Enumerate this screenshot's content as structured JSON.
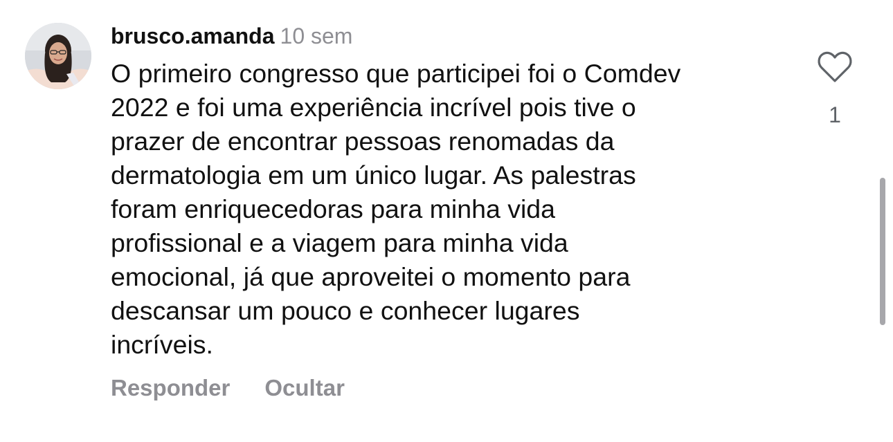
{
  "comment": {
    "username": "brusco.amanda",
    "time": "10 sem",
    "text": "O primeiro congresso que participei foi o Comdev\n2022 e foi uma experiência incrível pois tive o\nprazer de encontrar pessoas renomadas da\ndermatologia em um único lugar. As palestras\nforam enriquecedoras para minha vida\nprofissional e a viagem para minha vida\nemocional, já que aproveitei o momento para\ndescansar um pouco e conhecer lugares\nincríveis.",
    "likes": "1",
    "reply_label": "Responder",
    "hide_label": "Ocultar"
  },
  "icons": {
    "like": "heart-outline-icon",
    "avatar": "profile-photo"
  },
  "colors": {
    "text": "#111111",
    "muted": "#8e8e93",
    "icon": "#5f6368",
    "scrollbar": "#a7a7ab"
  }
}
